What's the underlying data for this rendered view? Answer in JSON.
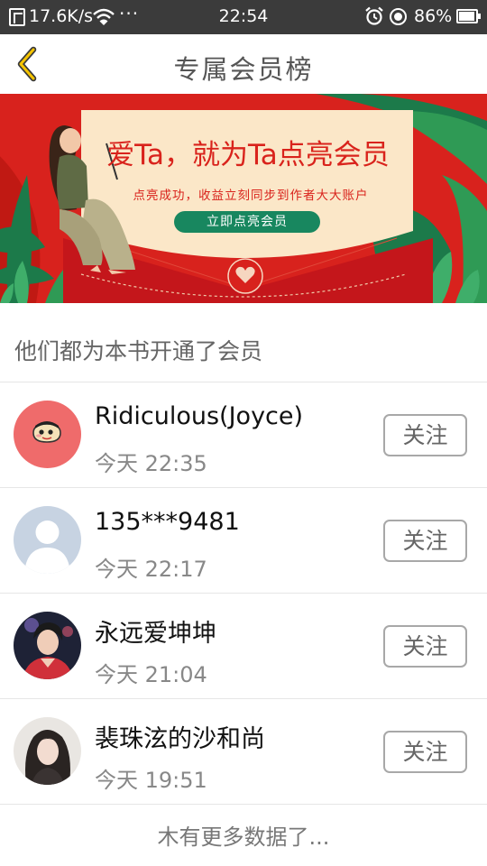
{
  "status_bar": {
    "net_speed": "17.6K/s",
    "dots": "···",
    "time": "22:54",
    "battery": "86%"
  },
  "nav": {
    "title": "专属会员榜",
    "back_icon": "chevron-left-icon"
  },
  "banner": {
    "title": "爱Ta，就为Ta点亮会员",
    "subtitle": "点亮成功，收益立刻同步到作者大大账户",
    "button": "立即点亮会员"
  },
  "section": {
    "title": "他们都为本书开通了会员"
  },
  "members": [
    {
      "name": "Ridiculous(Joyce)",
      "time": "今天 22:35",
      "follow_label": "关注",
      "avatar": "cartoon-avatar"
    },
    {
      "name": "135***9481",
      "time": "今天 22:17",
      "follow_label": "关注",
      "avatar": "default-avatar"
    },
    {
      "name": "永远爱坤坤",
      "time": "今天 21:04",
      "follow_label": "关注",
      "avatar": "photo-avatar"
    },
    {
      "name": "裴珠泫的沙和尚",
      "time": "今天 19:51",
      "follow_label": "关注",
      "avatar": "photo-avatar"
    }
  ],
  "footer": {
    "text": "木有更多数据了..."
  },
  "colors": {
    "accent_yellow": "#f5c400",
    "banner_red": "#d8221d",
    "banner_green": "#18875f"
  }
}
